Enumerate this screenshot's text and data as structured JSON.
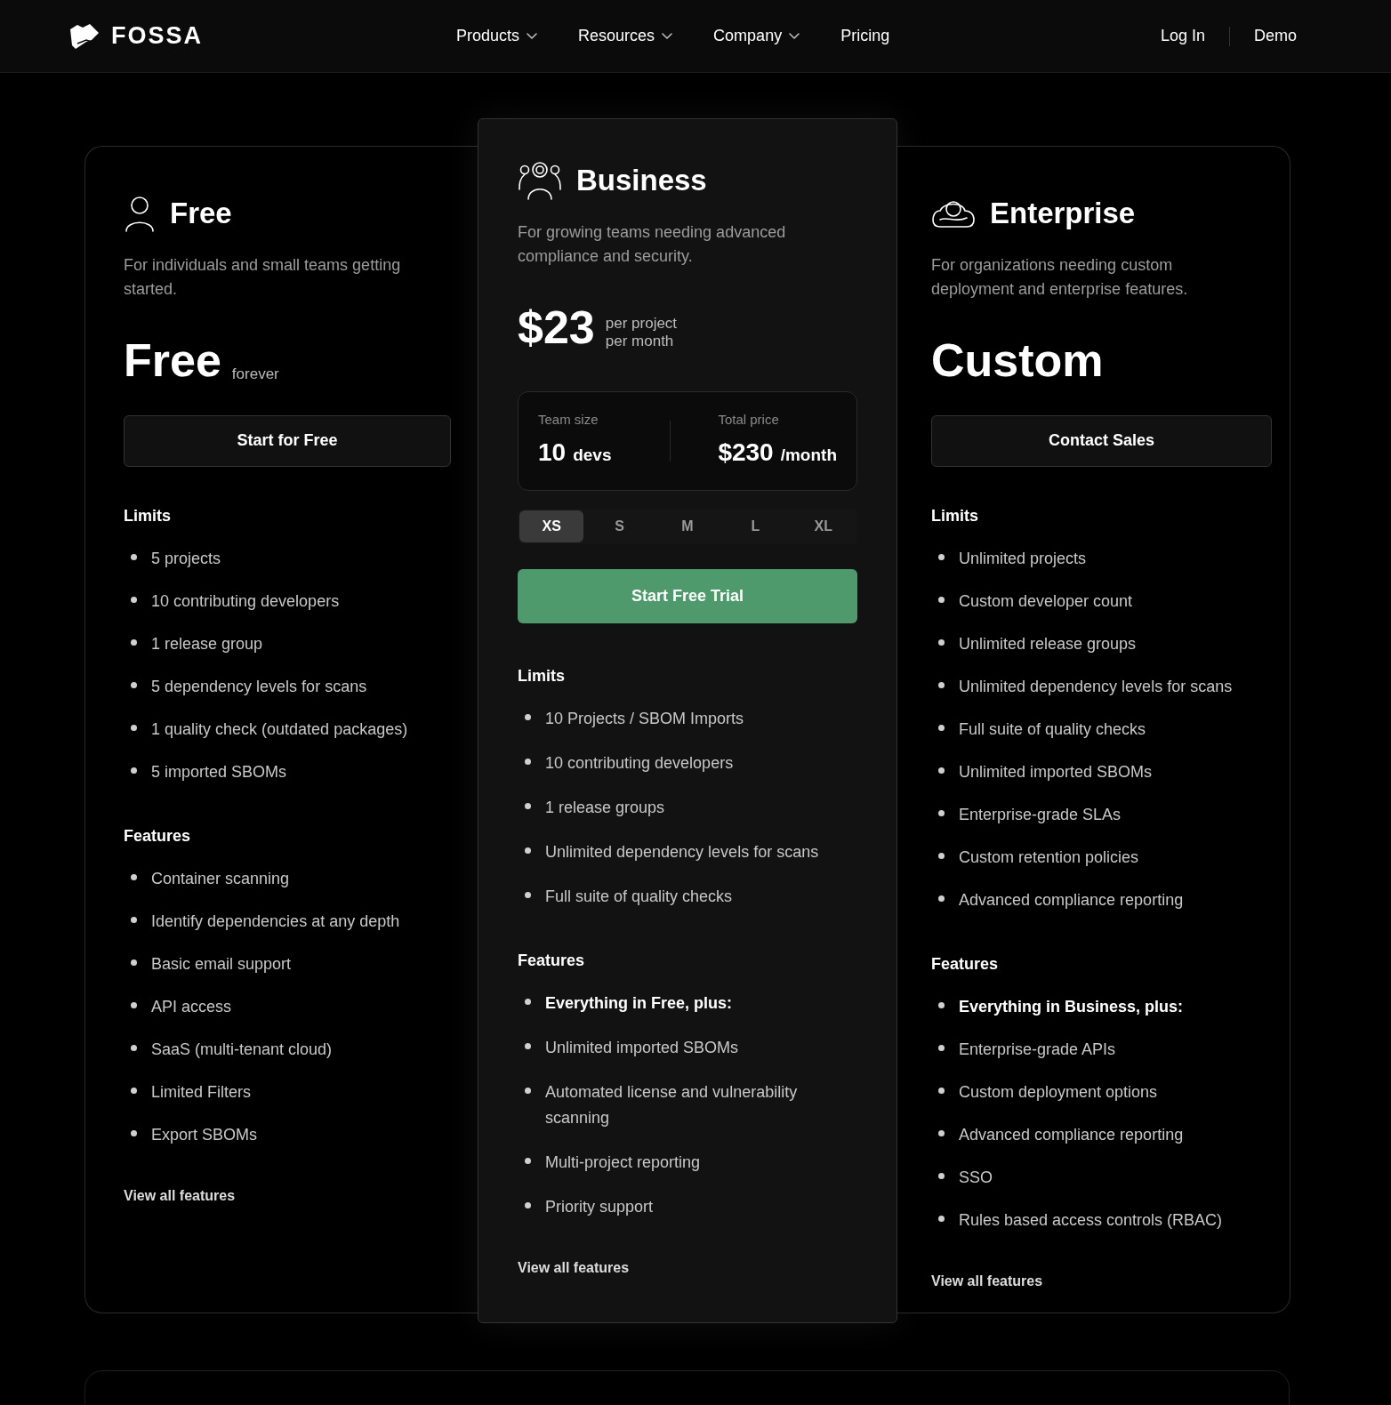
{
  "nav": {
    "brand": "FOSSA",
    "links": [
      {
        "label": "Products",
        "dropdown": true
      },
      {
        "label": "Resources",
        "dropdown": true
      },
      {
        "label": "Company",
        "dropdown": true
      },
      {
        "label": "Pricing",
        "dropdown": false
      }
    ],
    "login": "Log In",
    "demo": "Demo"
  },
  "plans": [
    {
      "kind": "free",
      "name": "Free",
      "description": "For individuals and small teams getting started.",
      "price": "Free",
      "price_note": [
        "forever"
      ],
      "button": "Start for Free",
      "limits_title": "Limits",
      "limits": [
        {
          "text": "5 projects",
          "bold": false
        },
        {
          "text": "10 contributing developers",
          "bold": false
        },
        {
          "text": "1 release group",
          "bold": false
        },
        {
          "text": "5 dependency levels for scans",
          "bold": false
        },
        {
          "text": "1 quality check (outdated packages)",
          "bold": false
        },
        {
          "text": "5 imported SBOMs",
          "bold": false
        }
      ],
      "features_title": "Features",
      "features": [
        {
          "text": "Container scanning",
          "bold": false
        },
        {
          "text": "Identify dependencies at any depth",
          "bold": false
        },
        {
          "text": "Basic email support",
          "bold": false
        },
        {
          "text": "API access",
          "bold": false
        },
        {
          "text": "SaaS (multi-tenant cloud)",
          "bold": false
        },
        {
          "text": "Limited Filters",
          "bold": false
        },
        {
          "text": "Export SBOMs",
          "bold": false
        }
      ],
      "more": "View all features"
    },
    {
      "kind": "business",
      "name": "Business",
      "description": "For growing teams needing advanced compliance and security.",
      "price": "$23",
      "price_note": [
        "per project",
        "per month"
      ],
      "calculator": {
        "team_label": "Team size",
        "team_value": "10",
        "team_unit": "devs",
        "total_label": "Total price",
        "total_value": "$230",
        "total_unit": "/month",
        "sizes": [
          {
            "label": "XS",
            "selected": true
          },
          {
            "label": "S",
            "selected": false
          },
          {
            "label": "M",
            "selected": false
          },
          {
            "label": "L",
            "selected": false
          },
          {
            "label": "XL",
            "selected": false
          }
        ]
      },
      "button": "Start Free Trial",
      "limits_title": "Limits",
      "limits": [
        {
          "text": "10 Projects / SBOM Imports",
          "bold": false
        },
        {
          "text": "10 contributing developers",
          "bold": false
        },
        {
          "text": "1 release groups",
          "bold": false
        },
        {
          "text": "Unlimited dependency levels for scans",
          "bold": false
        },
        {
          "text": "Full suite of quality checks",
          "bold": false
        }
      ],
      "features_title": "Features",
      "features": [
        {
          "text": "Everything in Free, plus:",
          "bold": true
        },
        {
          "text": "Unlimited imported SBOMs",
          "bold": false
        },
        {
          "text": "Automated license and vulnerability scanning",
          "bold": false
        },
        {
          "text": "Multi-project reporting",
          "bold": false
        },
        {
          "text": "Priority support",
          "bold": false
        }
      ],
      "more": "View all features"
    },
    {
      "kind": "enterprise",
      "name": "Enterprise",
      "description": "For organizations needing custom deployment and enterprise features.",
      "price": "Custom",
      "button": "Contact Sales",
      "limits_title": "Limits",
      "limits": [
        {
          "text": "Unlimited projects",
          "bold": false
        },
        {
          "text": "Custom developer count",
          "bold": false
        },
        {
          "text": "Unlimited release groups",
          "bold": false
        },
        {
          "text": "Unlimited dependency levels for scans",
          "bold": false
        },
        {
          "text": "Full suite of quality checks",
          "bold": false
        },
        {
          "text": "Unlimited imported SBOMs",
          "bold": false
        },
        {
          "text": "Enterprise-grade SLAs",
          "bold": false
        },
        {
          "text": "Custom retention policies",
          "bold": false
        },
        {
          "text": "Advanced compliance reporting",
          "bold": false
        }
      ],
      "features_title": "Features",
      "features": [
        {
          "text": "Everything in Business, plus:",
          "bold": true
        },
        {
          "text": "Enterprise-grade APIs",
          "bold": false
        },
        {
          "text": "Custom deployment options",
          "bold": false
        },
        {
          "text": "Advanced compliance reporting",
          "bold": false
        },
        {
          "text": "SSO",
          "bold": false
        },
        {
          "text": "Rules based access controls (RBAC)",
          "bold": false
        }
      ],
      "more": "View all features"
    }
  ]
}
